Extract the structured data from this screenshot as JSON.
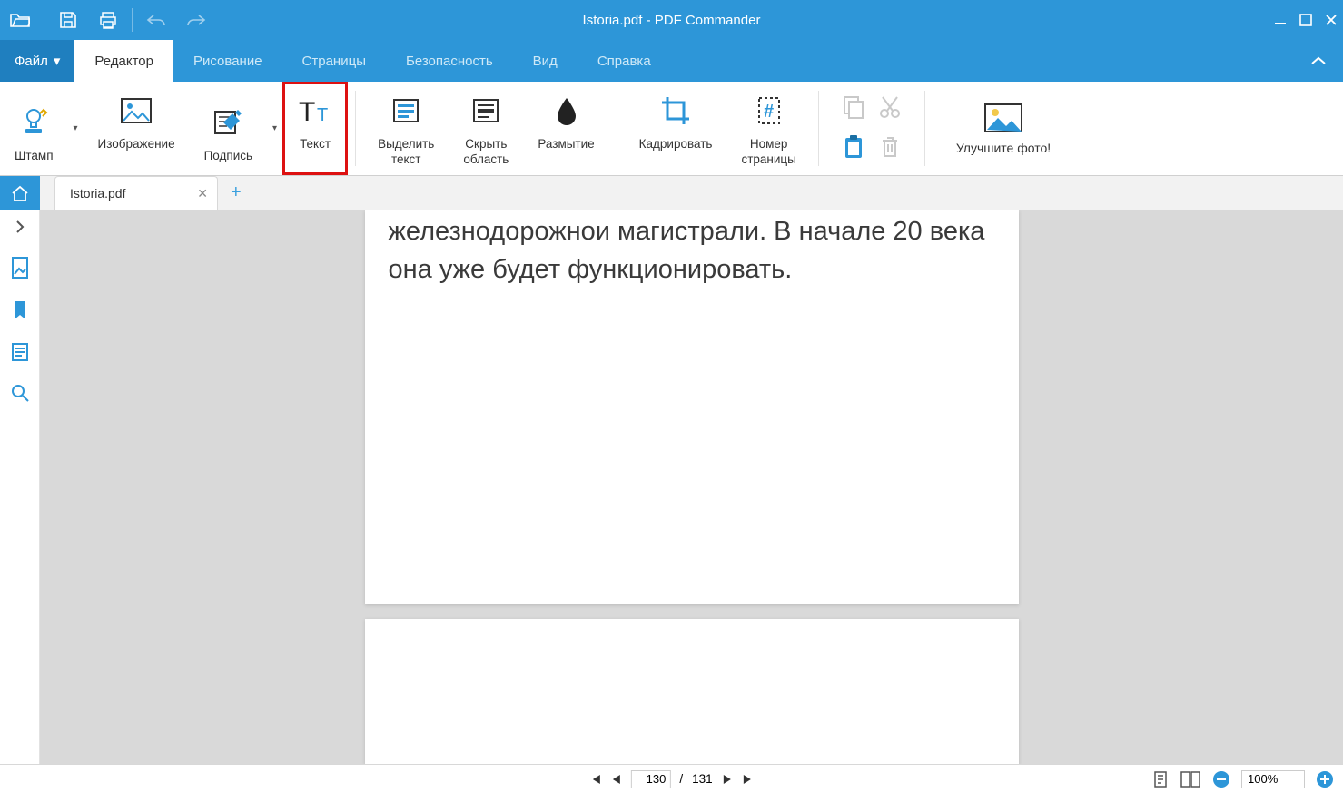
{
  "window": {
    "title": "Istoria.pdf - PDF Commander"
  },
  "menu": {
    "file_label": "Файл",
    "items": [
      {
        "label": "Редактор",
        "active": true
      },
      {
        "label": "Рисование",
        "active": false
      },
      {
        "label": "Страницы",
        "active": false
      },
      {
        "label": "Безопасность",
        "active": false
      },
      {
        "label": "Вид",
        "active": false
      },
      {
        "label": "Справка",
        "active": false
      }
    ]
  },
  "ribbon": {
    "stamp": "Штамп",
    "image": "Изображение",
    "signature": "Подпись",
    "text": "Текст",
    "highlight_text": "Выделить\nтекст",
    "hide_area": "Скрыть\nобласть",
    "blur": "Размытие",
    "crop": "Кадрировать",
    "page_number": "Номер\nстраницы",
    "promo": "Улучшите фото!"
  },
  "tabs": {
    "items": [
      {
        "label": "Istoria.pdf"
      }
    ]
  },
  "document": {
    "page1_text": "железнодорожнои магистрали. В начале 20 века она уже будет функционировать."
  },
  "status": {
    "current_page": "130",
    "total_pages": "131",
    "zoom": "100%"
  }
}
